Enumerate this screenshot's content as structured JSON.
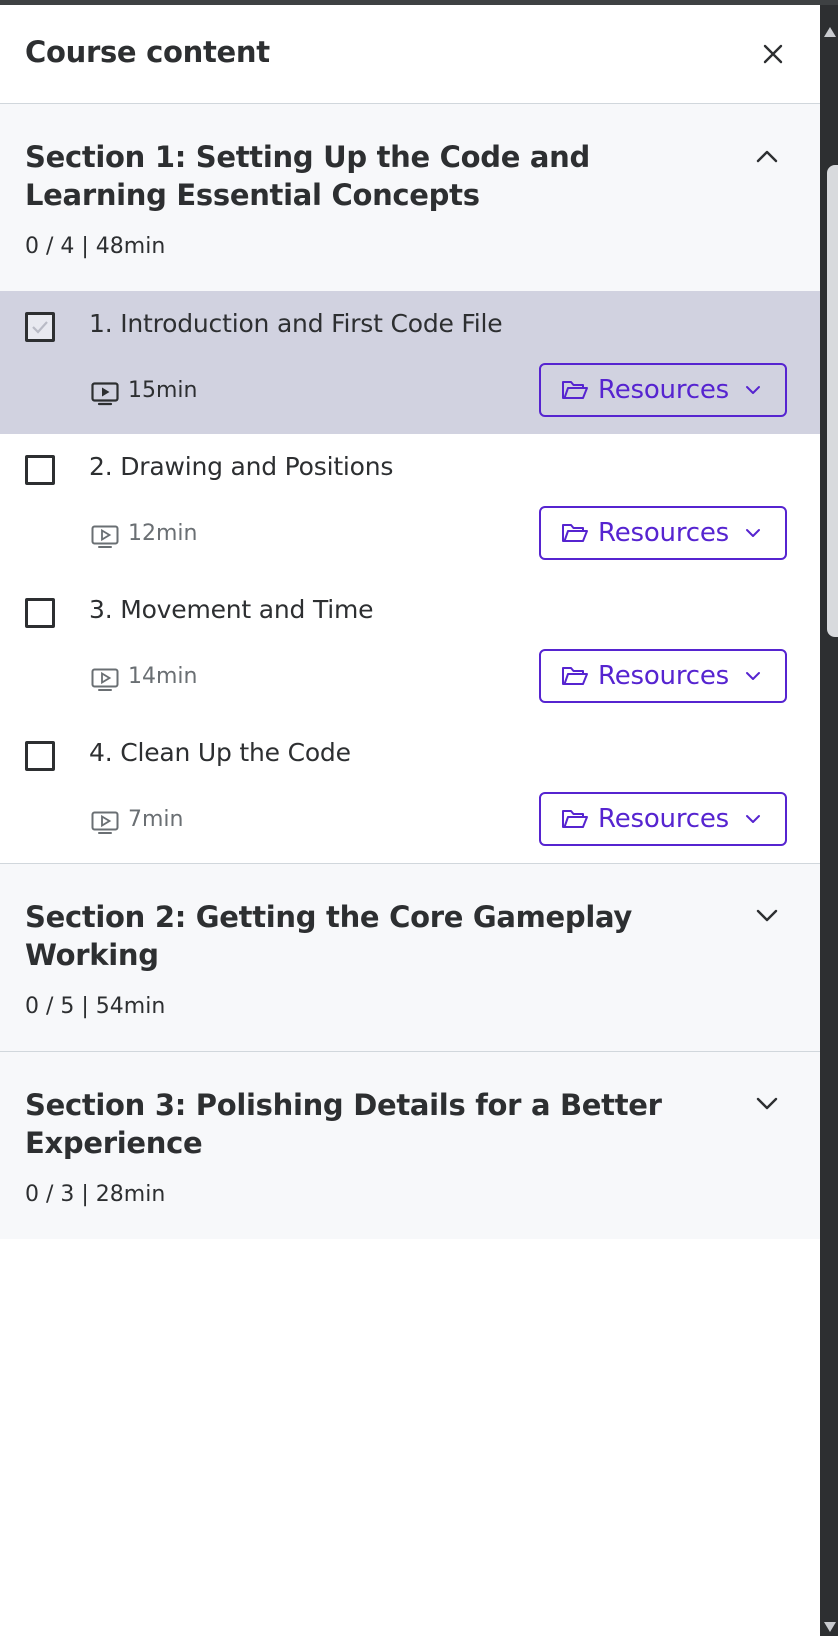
{
  "panel": {
    "title": "Course content"
  },
  "sections": [
    {
      "title": "Section 1: Setting Up the Code and Learning Essential Concepts",
      "meta": "0 / 4 | 48min",
      "expanded": true,
      "lectures": [
        {
          "title": "1. Introduction and First Code File",
          "duration": "15min",
          "resources_label": "Resources",
          "active": true
        },
        {
          "title": "2. Drawing and Positions",
          "duration": "12min",
          "resources_label": "Resources"
        },
        {
          "title": "3. Movement and Time",
          "duration": "14min",
          "resources_label": "Resources"
        },
        {
          "title": "4. Clean Up the Code",
          "duration": "7min",
          "resources_label": "Resources"
        }
      ]
    },
    {
      "title": "Section 2: Getting the Core Gameplay Working",
      "meta": "0 / 5 | 54min",
      "expanded": false
    },
    {
      "title": "Section 3: Polishing Details for a Better Experience",
      "meta": "0 / 3 | 28min",
      "expanded": false
    }
  ],
  "colors": {
    "accent": "#5624d0",
    "active_row": "#d1d2e0",
    "section_bg": "#f7f8fa",
    "text": "#2d2f31"
  }
}
